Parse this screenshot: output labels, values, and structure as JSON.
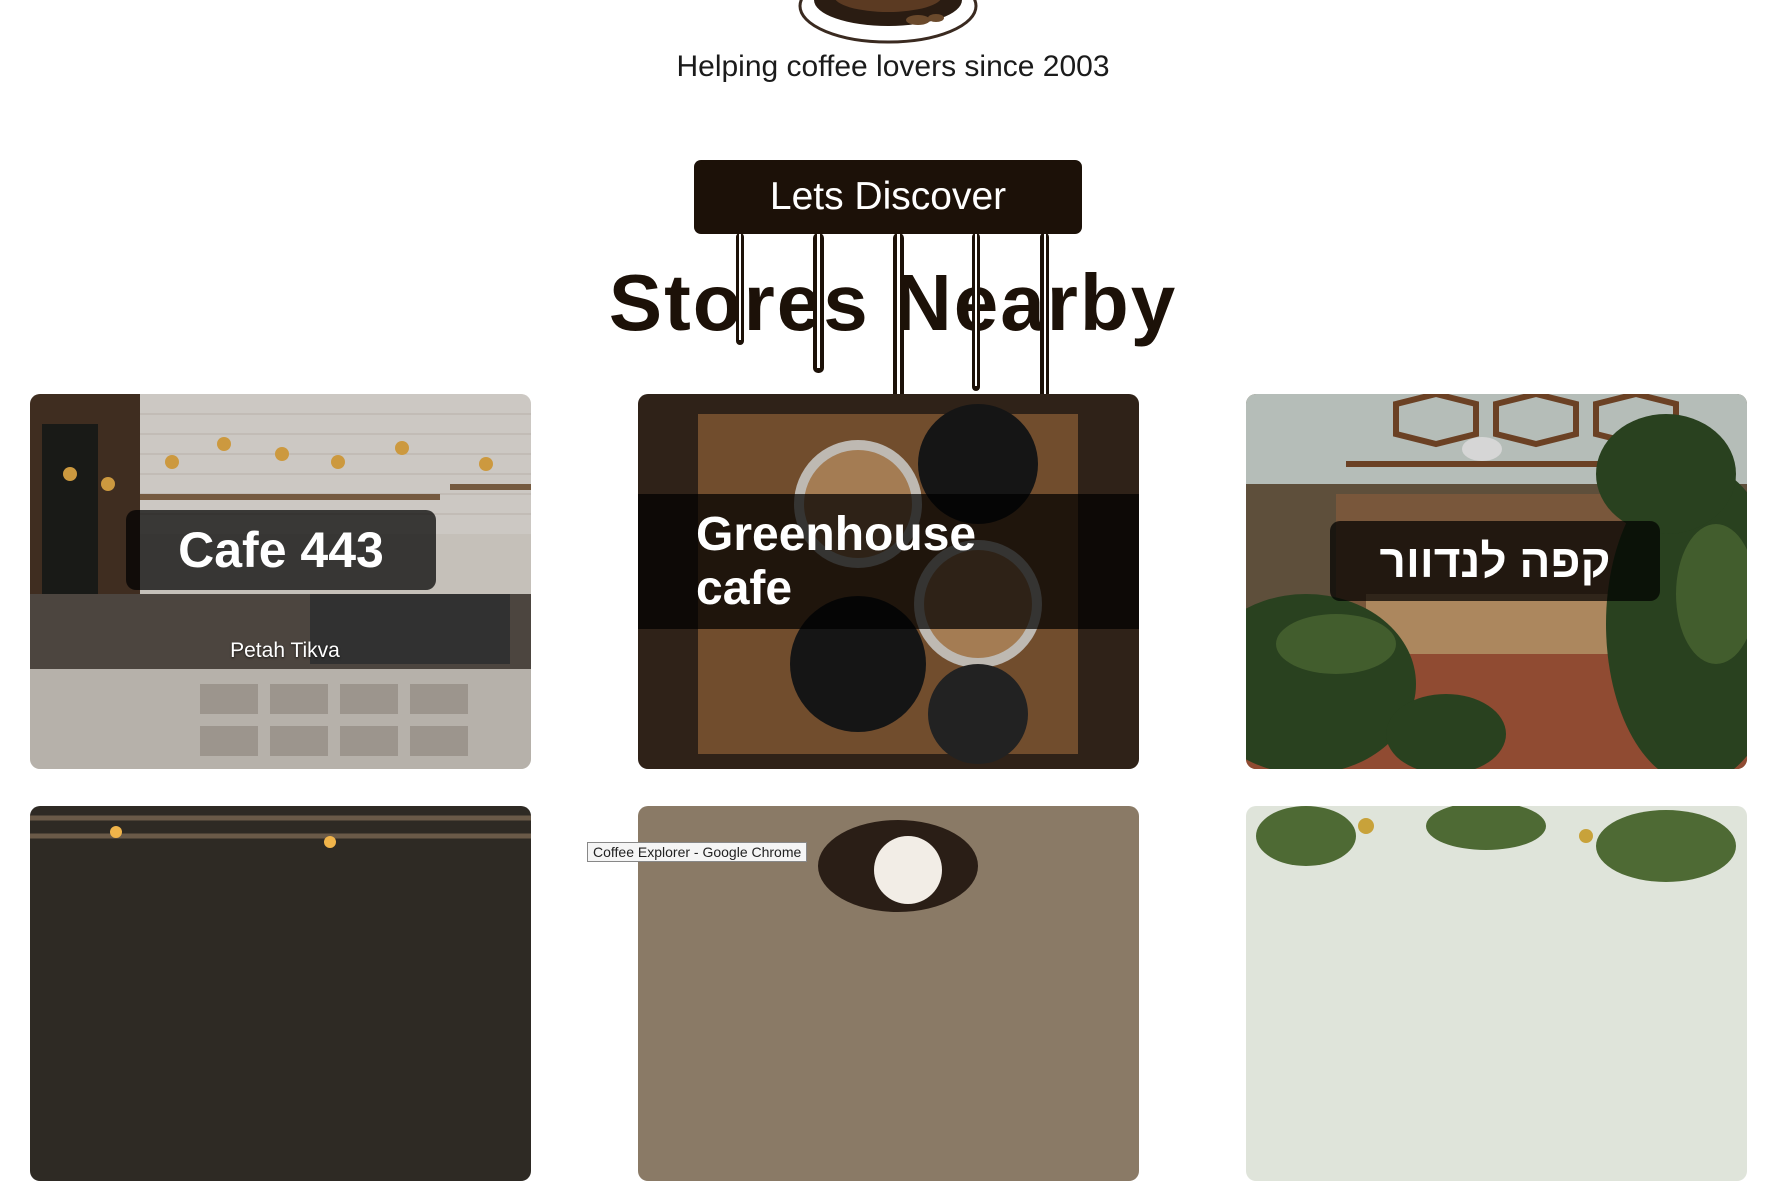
{
  "header": {
    "logo_icon": "coffee-cup-logo",
    "tagline": "Helping coffee lovers since 2003"
  },
  "discover_button": {
    "label": "Lets Discover"
  },
  "section_title": "Stores Nearby",
  "stores": [
    {
      "name": "Cafe 443",
      "city": "Petah Tikva"
    },
    {
      "name": "Greenhouse cafe",
      "city": ""
    },
    {
      "name": "קפה לנדוור",
      "city": ""
    },
    {
      "name": "",
      "city": ""
    },
    {
      "name": "",
      "city": ""
    },
    {
      "name": "",
      "city": ""
    }
  ],
  "tooltip": "Coffee Explorer - Google Chrome",
  "colors": {
    "brand_dark": "#1c1108",
    "background": "#ffffff"
  }
}
